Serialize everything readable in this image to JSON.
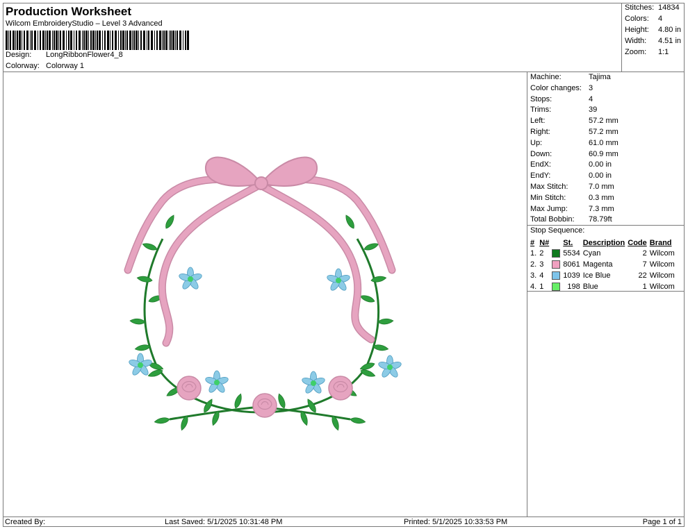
{
  "header": {
    "title": "Production Worksheet",
    "subtitle": "Wilcom EmbroideryStudio – Level 3 Advanced",
    "design_label": "Design:",
    "design_value": "LongRibbonFlower4_8",
    "colorway_label": "Colorway:",
    "colorway_value": "Colorway 1"
  },
  "stats": [
    {
      "label": "Stitches:",
      "value": "14834"
    },
    {
      "label": "Colors:",
      "value": "4"
    },
    {
      "label": "Height:",
      "value": "4.80 in"
    },
    {
      "label": "Width:",
      "value": "4.51 in"
    },
    {
      "label": "Zoom:",
      "value": "1:1"
    }
  ],
  "machine_props": [
    {
      "label": "Machine:",
      "value": "Tajima"
    },
    {
      "label": "Color changes:",
      "value": "3"
    },
    {
      "label": "Stops:",
      "value": "4"
    },
    {
      "label": "Trims:",
      "value": "39"
    },
    {
      "label": "Left:",
      "value": "57.2 mm"
    },
    {
      "label": "Right:",
      "value": "57.2 mm"
    },
    {
      "label": "Up:",
      "value": "61.0 mm"
    },
    {
      "label": "Down:",
      "value": "60.9 mm"
    },
    {
      "label": "EndX:",
      "value": "0.00 in"
    },
    {
      "label": "EndY:",
      "value": "0.00 in"
    },
    {
      "label": "Max Stitch:",
      "value": "7.0 mm"
    },
    {
      "label": "Min Stitch:",
      "value": "0.3 mm"
    },
    {
      "label": "Max Jump:",
      "value": "7.3 mm"
    },
    {
      "label": "Total Bobbin:",
      "value": "78.79ft"
    }
  ],
  "stop_sequence": {
    "title": "Stop Sequence:",
    "headers": {
      "idx": "#",
      "n": "N#",
      "st": "St.",
      "desc": "Description",
      "code": "Code",
      "brand": "Brand"
    },
    "rows": [
      {
        "idx": "1.",
        "n": "2",
        "color": "#0f7a1e",
        "st": "5534",
        "desc": "Cyan",
        "code": "2",
        "brand": "Wilcom"
      },
      {
        "idx": "2.",
        "n": "3",
        "color": "#f0a0c0",
        "st": "8061",
        "desc": "Magenta",
        "code": "7",
        "brand": "Wilcom"
      },
      {
        "idx": "3.",
        "n": "4",
        "color": "#7ec4ea",
        "st": "1039",
        "desc": "Ice Blue",
        "code": "22",
        "brand": "Wilcom"
      },
      {
        "idx": "4.",
        "n": "1",
        "color": "#66ee66",
        "st": "198",
        "desc": "Blue",
        "code": "1",
        "brand": "Wilcom"
      }
    ]
  },
  "footer": {
    "created_by": "Created By:",
    "last_saved": "Last Saved: 5/1/2025 10:31:48 PM",
    "printed": "Printed: 5/1/2025 10:33:53 PM",
    "page": "Page 1 of 1"
  },
  "palette": {
    "ribbon": "#e6a4c0",
    "ribbon_edge": "#c98aa6",
    "leaf": "#2e9e3e",
    "leaf_dark": "#1f7a2b",
    "petal": "#8ccbe6",
    "center": "#3fcf6a"
  }
}
